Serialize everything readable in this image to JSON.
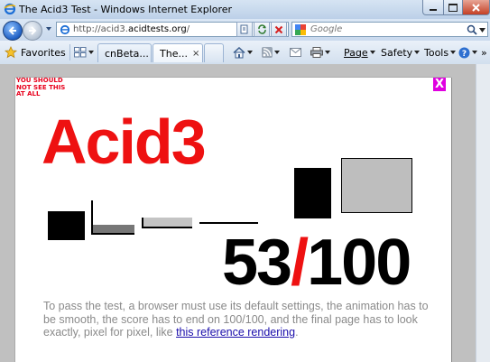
{
  "window": {
    "title": "The Acid3 Test - Windows Internet Explorer"
  },
  "address_bar": {
    "url_prefix": "http://acid3.",
    "url_domain": "acidtests.org",
    "url_suffix": "/"
  },
  "search": {
    "placeholder": "Google"
  },
  "toolbar": {
    "favorites_label": "Favorites",
    "tabs": [
      {
        "label": "cnBeta..."
      },
      {
        "label": "The...",
        "close": "×"
      }
    ],
    "commands": [
      {
        "label": "Page"
      },
      {
        "label": "Safety"
      },
      {
        "label": "Tools"
      }
    ],
    "chevron": "»"
  },
  "page": {
    "warning_text": "YOU SHOULD NOT SEE THIS AT ALL",
    "close_glyph": "X",
    "acid_text": "Acid3",
    "score_value": "53",
    "score_sep": "/",
    "score_total": "100",
    "instructions_text": "To pass the test, a browser must use its default settings, the animation has to be smooth, the score has to end on 100/100, and the final page has to look exactly, pixel for pixel, like",
    "instructions_link": "this reference rendering",
    "instructions_end": "."
  },
  "colors": {
    "acid_red": "#ee1111",
    "warning_red": "#e8001c",
    "close_magenta": "#e000e0",
    "link_blue": "#1a0dab"
  }
}
